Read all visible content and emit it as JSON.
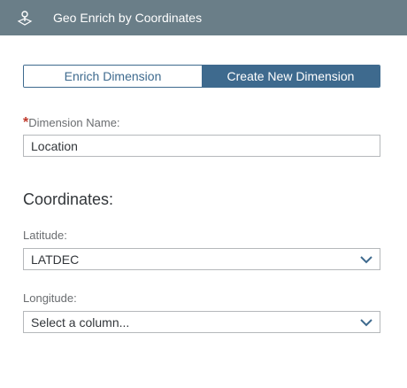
{
  "header": {
    "title": "Geo Enrich by Coordinates",
    "icon": "location-pin-icon",
    "background": "#6a7e88"
  },
  "segmented": {
    "options": [
      "Enrich Dimension",
      "Create New Dimension"
    ],
    "selected": "Create New Dimension",
    "accent": "#3e6a8e"
  },
  "dimension": {
    "required_mark": "*",
    "label": "Dimension Name:",
    "value": "Location"
  },
  "coordinates": {
    "title": "Coordinates:",
    "latitude": {
      "label": "Latitude:",
      "value": "LATDEC"
    },
    "longitude": {
      "label": "Longitude:",
      "value": "Select a column..."
    }
  }
}
